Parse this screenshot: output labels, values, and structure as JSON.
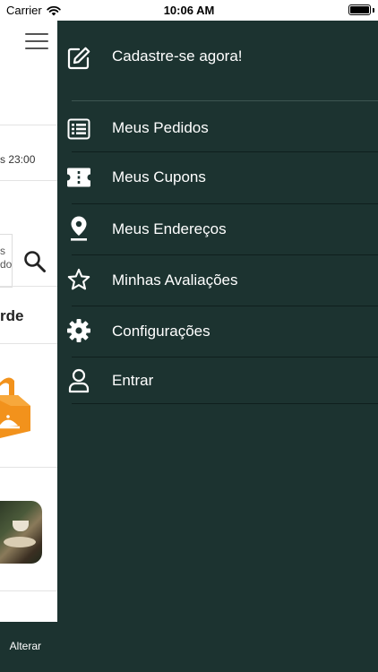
{
  "status_bar": {
    "carrier": "Carrier",
    "time": "10:06 AM"
  },
  "background": {
    "hours_fragment": "s 23:00",
    "search_fragment_1": "s",
    "search_fragment_2": "do",
    "section_fragment": "rde",
    "bottom_button": "Alterar",
    "bottom_bar_color": "#1c3330"
  },
  "drawer": {
    "background_color": "#1c3330",
    "text_color": "#ffffff",
    "header": {
      "label": "Cadastre-se agora!",
      "icon": "edit-icon"
    },
    "items": [
      {
        "label": "Meus Pedidos",
        "icon": "list-icon"
      },
      {
        "label": "Meus Cupons",
        "icon": "ticket-icon"
      },
      {
        "label": "Meus Endereços",
        "icon": "location-pin-icon"
      },
      {
        "label": "Minhas Avaliações",
        "icon": "star-icon"
      },
      {
        "label": "Configurações",
        "icon": "gear-icon"
      },
      {
        "label": "Entrar",
        "icon": "user-icon"
      }
    ]
  }
}
